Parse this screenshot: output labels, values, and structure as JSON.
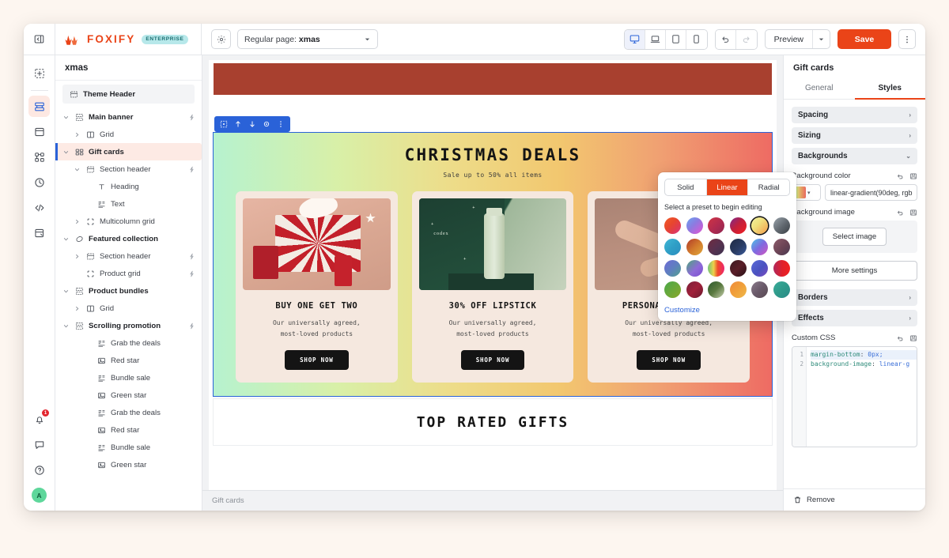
{
  "topbar": {
    "collapse_icon": "panel-collapse-icon",
    "logo_text": "FOXIFY",
    "badge": "ENTERPRISE",
    "settings_icon": "gear-icon",
    "page_select_prefix": "Regular page: ",
    "page_select_value": "xmas",
    "devices": [
      {
        "name": "device-desktop",
        "icon": "desktop-icon",
        "active": true
      },
      {
        "name": "device-laptop",
        "icon": "laptop-icon",
        "active": false
      },
      {
        "name": "device-tablet",
        "icon": "tablet-icon",
        "active": false
      },
      {
        "name": "device-mobile",
        "icon": "mobile-icon",
        "active": false
      }
    ],
    "undo_icon": "undo-arrow-icon",
    "redo_icon": "redo-arrow-icon",
    "preview_label": "Preview",
    "save_label": "Save",
    "kebab_icon": "vertical-dots-icon",
    "accent_color": "#ea4418"
  },
  "rail": {
    "top_items": [
      {
        "name": "rail-add-section",
        "icon": "add-square-icon",
        "active": false
      },
      {
        "name": "rail-layers",
        "icon": "layers-icon",
        "active": true
      },
      {
        "name": "rail-templates",
        "icon": "window-icon",
        "active": false
      },
      {
        "name": "rail-components",
        "icon": "nodes-icon",
        "active": false
      },
      {
        "name": "rail-history",
        "icon": "clock-icon",
        "active": false
      },
      {
        "name": "rail-code",
        "icon": "code-icon",
        "active": false
      },
      {
        "name": "rail-integrations",
        "icon": "puzzle-icon",
        "active": false
      }
    ],
    "bottom_items": [
      {
        "name": "rail-notifications",
        "icon": "bell-icon",
        "badge": "1"
      },
      {
        "name": "rail-feedback",
        "icon": "chat-icon",
        "badge": ""
      },
      {
        "name": "rail-help",
        "icon": "question-circle-icon",
        "badge": ""
      }
    ],
    "avatar_initial": "A"
  },
  "tree": {
    "title": "xmas",
    "header_item": {
      "label": "Theme Header",
      "icon": "header-block-icon"
    },
    "items": [
      {
        "label": "Main banner",
        "icon": "section-icon",
        "indent": 0,
        "twisty": "down",
        "bold": true,
        "bolt": true,
        "selected": false
      },
      {
        "label": "Grid",
        "icon": "columns-icon",
        "indent": 1,
        "twisty": "right",
        "bold": false,
        "bolt": false,
        "selected": false
      },
      {
        "label": "Gift cards",
        "icon": "cards-grid-icon",
        "indent": 0,
        "twisty": "down",
        "bold": true,
        "bolt": false,
        "selected": true
      },
      {
        "label": "Section header",
        "icon": "header-block-icon",
        "indent": 1,
        "twisty": "down",
        "bold": false,
        "bolt": true,
        "selected": false
      },
      {
        "label": "Heading",
        "icon": "text-t-icon",
        "indent": 2,
        "twisty": "none",
        "bold": false,
        "bolt": false,
        "selected": false
      },
      {
        "label": "Text",
        "icon": "paragraph-icon",
        "indent": 2,
        "twisty": "none",
        "bold": false,
        "bolt": false,
        "selected": false
      },
      {
        "label": "Multicolumn grid",
        "icon": "dashed-box-icon",
        "indent": 1,
        "twisty": "right",
        "bold": false,
        "bolt": false,
        "selected": false
      },
      {
        "label": "Featured collection",
        "icon": "tag-icon",
        "indent": 0,
        "twisty": "down",
        "bold": true,
        "bolt": false,
        "selected": false
      },
      {
        "label": "Section header",
        "icon": "header-block-icon",
        "indent": 1,
        "twisty": "right",
        "bold": false,
        "bolt": true,
        "selected": false
      },
      {
        "label": "Product grid",
        "icon": "dashed-box-icon",
        "indent": 1,
        "twisty": "none",
        "bold": false,
        "bolt": true,
        "selected": false
      },
      {
        "label": "Product bundles",
        "icon": "section-icon",
        "indent": 0,
        "twisty": "down",
        "bold": true,
        "bolt": false,
        "selected": false
      },
      {
        "label": "Grid",
        "icon": "columns-icon",
        "indent": 1,
        "twisty": "right",
        "bold": false,
        "bolt": false,
        "selected": false
      },
      {
        "label": "Scrolling promotion",
        "icon": "section-icon",
        "indent": 0,
        "twisty": "down",
        "bold": true,
        "bolt": true,
        "selected": false
      },
      {
        "label": "Grab the deals",
        "icon": "paragraph-icon",
        "indent": 2,
        "twisty": "none",
        "bold": false,
        "bolt": false,
        "selected": false
      },
      {
        "label": "Red star",
        "icon": "image-icon",
        "indent": 2,
        "twisty": "none",
        "bold": false,
        "bolt": false,
        "selected": false
      },
      {
        "label": "Bundle sale",
        "icon": "paragraph-icon",
        "indent": 2,
        "twisty": "none",
        "bold": false,
        "bolt": false,
        "selected": false
      },
      {
        "label": "Green star",
        "icon": "image-icon",
        "indent": 2,
        "twisty": "none",
        "bold": false,
        "bolt": false,
        "selected": false
      },
      {
        "label": "Grab the deals",
        "icon": "paragraph-icon",
        "indent": 2,
        "twisty": "none",
        "bold": false,
        "bolt": false,
        "selected": false
      },
      {
        "label": "Red star",
        "icon": "image-icon",
        "indent": 2,
        "twisty": "none",
        "bold": false,
        "bolt": false,
        "selected": false
      },
      {
        "label": "Bundle sale",
        "icon": "paragraph-icon",
        "indent": 2,
        "twisty": "none",
        "bold": false,
        "bolt": false,
        "selected": false
      },
      {
        "label": "Green star",
        "icon": "image-icon",
        "indent": 2,
        "twisty": "none",
        "bold": false,
        "bolt": false,
        "selected": false
      }
    ]
  },
  "canvas": {
    "selection_toolbar": [
      {
        "name": "sel-move-handle",
        "icon": "move-target-icon"
      },
      {
        "name": "sel-move-up",
        "icon": "arrow-up-icon"
      },
      {
        "name": "sel-move-down",
        "icon": "arrow-down-icon"
      },
      {
        "name": "sel-hide",
        "icon": "eye-icon"
      },
      {
        "name": "sel-more",
        "icon": "vertical-dots-icon"
      }
    ],
    "top_banner_color": "#a8402f",
    "gift_section": {
      "title": "CHRISTMAS DEALS",
      "subtitle": "Sale up to 50% all items",
      "gradient": "linear-gradient(90deg,#b6f2cf,#d8f0a8,#eddd8a,#f2c76f,#f0a072,#ee6b63)",
      "cards": [
        {
          "title": "BUY ONE GET TWO",
          "desc_line1": "Our universally agreed,",
          "desc_line2": "most-loved products",
          "button": "SHOP NOW",
          "image": "gift-box-photo"
        },
        {
          "title": "30% OFF LIPSTICK",
          "desc_line1": "Our universally agreed,",
          "desc_line2": "most-loved products",
          "button": "SHOP NOW",
          "image": "codex-serum-photo"
        },
        {
          "title": "PERSONAL GIFT BOX",
          "desc_line1": "Our universally agreed,",
          "desc_line2": "most-loved products",
          "button": "SHOP NOW",
          "image": "hands-photo"
        }
      ]
    },
    "next_section_title": "TOP RATED GIFTS",
    "status_label": "Gift cards"
  },
  "popover": {
    "tabs": [
      {
        "label": "Solid",
        "active": false
      },
      {
        "label": "Linear",
        "active": true
      },
      {
        "label": "Radial",
        "active": false
      }
    ],
    "hint": "Select a preset to begin editing",
    "customize_label": "Customize",
    "presets": [
      {
        "css": "linear-gradient(135deg,#f25c2a,#e8472c 40%,#e03b4f 70%,#d93a8c)",
        "selected": false
      },
      {
        "css": "linear-gradient(135deg,#6aa4f0,#8e7ae0 45%,#c661d8 80%,#d46fc0)",
        "selected": false
      },
      {
        "css": "linear-gradient(135deg,#cf3444,#b02a50 55%,#8e2750)",
        "selected": false
      },
      {
        "css": "linear-gradient(135deg,#7b2a8f,#c0203e 45%,#f31f1f)",
        "selected": false
      },
      {
        "css": "linear-gradient(135deg,#f2f0a0,#f0e07c 40%,#f2b35c 80%,#f0a24e)",
        "selected": true
      },
      {
        "css": "linear-gradient(135deg,#9aa3ab,#60676e 55%,#3b4046)",
        "selected": false
      },
      {
        "css": "linear-gradient(135deg,#3fb6d6,#2f9fc6 50%,#2d8ec0)",
        "selected": false
      },
      {
        "css": "linear-gradient(135deg,#b03a2a,#d1782c 50%,#e0a83a)",
        "selected": false
      },
      {
        "css": "linear-gradient(135deg,#6f2b3f,#58314f 50%,#3c3350)",
        "selected": false
      },
      {
        "css": "linear-gradient(135deg,#1f2a44,#2a3c63 55%,#3b5a9c)",
        "selected": false
      },
      {
        "css": "linear-gradient(135deg,#49c4e6,#7f6ae0 50%,#d455c0)",
        "selected": false
      },
      {
        "css": "linear-gradient(135deg,#8c5a6a,#6b4455 55%,#4a3a52)",
        "selected": false
      },
      {
        "css": "linear-gradient(135deg,#6e6ad6,#5f7fc0 50%,#52a08e)",
        "selected": false
      },
      {
        "css": "linear-gradient(135deg,#4aa87a,#8e6ad8 55%,#7a4fd0)",
        "selected": false
      },
      {
        "css": "linear-gradient(90deg,#6ec27a,#ecd24a 35%,#ef4a2a 60%,#ee2470)",
        "selected": false
      },
      {
        "css": "linear-gradient(135deg,#3b1a22,#5a1e28 50%,#2a1218)",
        "selected": false
      },
      {
        "css": "linear-gradient(135deg,#5a6ad8,#4a52c0 55%,#7a4ac0)",
        "selected": false
      },
      {
        "css": "linear-gradient(90deg,#b0285c,#e0202a 55%,#f02020)",
        "selected": false
      },
      {
        "css": "linear-gradient(135deg,#4aa84a,#6aa83a 50%,#8aa82a)",
        "selected": false
      },
      {
        "css": "linear-gradient(135deg,#7a1f3a,#a0203a 50%,#6a1a2e)",
        "selected": false
      },
      {
        "css": "linear-gradient(135deg,#2e5a2e,#5a7a40 50%,#c8d0b0)",
        "selected": false
      },
      {
        "css": "linear-gradient(135deg,#f08a3a,#f0a03a 50%,#eeb84a)",
        "selected": false
      },
      {
        "css": "linear-gradient(135deg,#8a7a8a,#6a5a6a 50%,#5a4a52)",
        "selected": false
      },
      {
        "css": "linear-gradient(135deg,#3aab9a,#2f9a8a 50%,#2a8a88)",
        "selected": false
      }
    ]
  },
  "right_panel": {
    "title": "Gift cards",
    "tabs": [
      {
        "label": "General",
        "active": false
      },
      {
        "label": "Styles",
        "active": true
      }
    ],
    "accordions": [
      {
        "label": "Spacing",
        "state": "collapsed"
      },
      {
        "label": "Sizing",
        "state": "collapsed"
      },
      {
        "label": "Backgrounds",
        "state": "expanded"
      }
    ],
    "background_color": {
      "label": "Background color",
      "value": "linear-gradient(90deg, rgb",
      "reset_icon": "reset-arrow-icon",
      "save_icon": "save-disk-icon"
    },
    "background_image": {
      "label": "Background image",
      "button": "Select image",
      "reset_icon": "reset-arrow-icon",
      "save_icon": "save-disk-icon"
    },
    "more_settings_label": "More settings",
    "accordions2": [
      {
        "label": "Borders",
        "state": "collapsed"
      },
      {
        "label": "Effects",
        "state": "collapsed"
      }
    ],
    "custom_css": {
      "label": "Custom CSS",
      "reset_icon": "reset-arrow-icon",
      "save_icon": "save-disk-icon",
      "lines": [
        {
          "num": "1",
          "prop": "margin-bottom",
          "value": " 0px;"
        },
        {
          "num": "2",
          "prop": "background-image",
          "value": " linear-g"
        }
      ]
    },
    "remove_label": "Remove",
    "remove_icon": "trash-icon"
  }
}
